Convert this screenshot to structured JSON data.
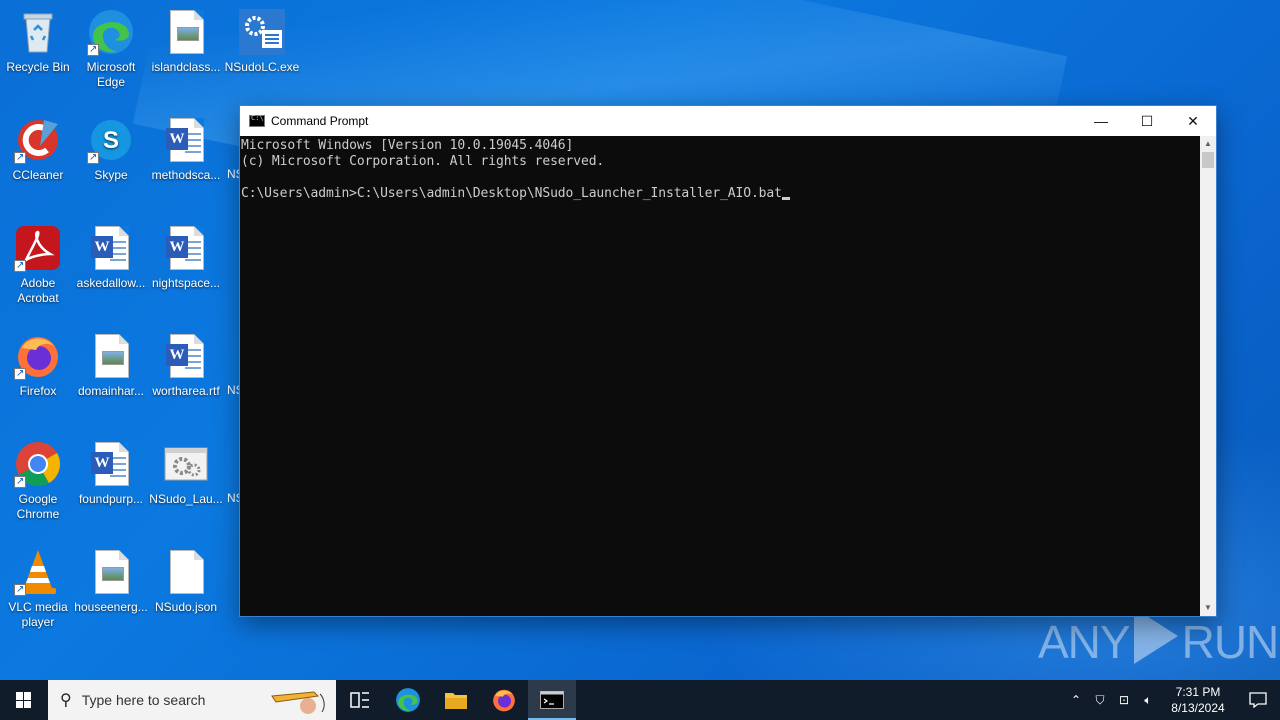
{
  "desktop": {
    "icons": [
      {
        "label": "Recycle Bin"
      },
      {
        "label": "Microsoft Edge"
      },
      {
        "label": "islandclass..."
      },
      {
        "label": "NSudoLC.exe"
      },
      {
        "label": "CCleaner"
      },
      {
        "label": "Skype"
      },
      {
        "label": "methodsca..."
      },
      {
        "label": "Adobe Acrobat"
      },
      {
        "label": "askedallow..."
      },
      {
        "label": "nightspace..."
      },
      {
        "label": "Firefox"
      },
      {
        "label": "domainhar..."
      },
      {
        "label": "wortharea.rtf"
      },
      {
        "label": "Google Chrome"
      },
      {
        "label": "foundpurp..."
      },
      {
        "label": "NSudo_Lau..."
      },
      {
        "label": "VLC media player"
      },
      {
        "label": "houseenerg..."
      },
      {
        "label": "NSudo.json"
      }
    ],
    "partial_labels": [
      "NS",
      "NS",
      "NS"
    ]
  },
  "window": {
    "title": "Command Prompt",
    "minimize_glyph": "—",
    "maximize_glyph": "☐",
    "close_glyph": "✕",
    "console_lines": [
      "Microsoft Windows [Version 10.0.19045.4046]",
      "(c) Microsoft Corporation. All rights reserved.",
      "",
      "C:\\Users\\admin>C:\\Users\\admin\\Desktop\\NSudo_Launcher_Installer_AIO.bat"
    ]
  },
  "watermark": {
    "left": "ANY",
    "right": "RUN"
  },
  "taskbar": {
    "search_placeholder": "Type here to search",
    "pinned": [
      "task-view",
      "edge",
      "file-explorer",
      "firefox",
      "command-prompt"
    ],
    "time": "7:31 PM",
    "date": "8/13/2024"
  }
}
